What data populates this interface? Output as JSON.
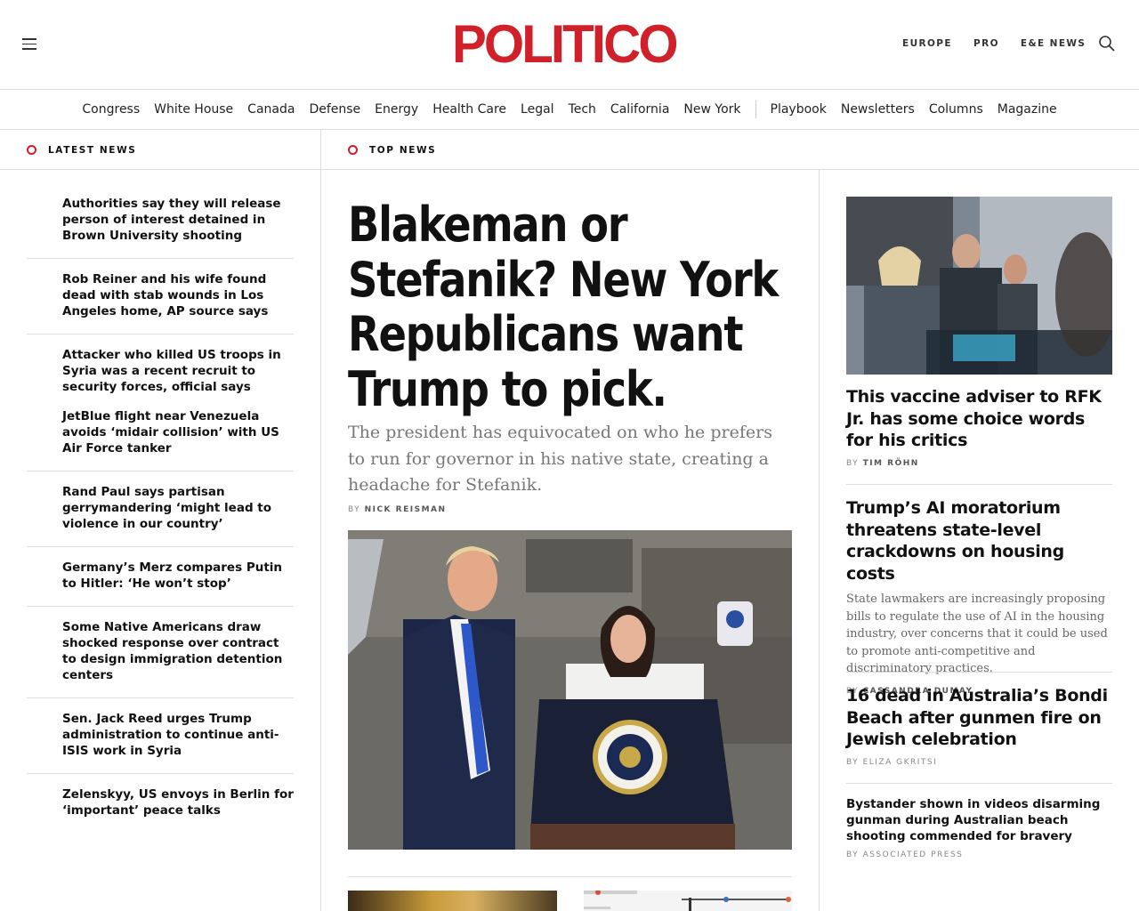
{
  "header": {
    "logo": "POLITICO",
    "links": [
      "EUROPE",
      "PRO",
      "E&E NEWS"
    ]
  },
  "nav": {
    "sections": [
      "Congress",
      "White House",
      "Canada",
      "Defense",
      "Energy",
      "Health Care",
      "Legal",
      "Tech",
      "California",
      "New York"
    ],
    "extras": [
      "Playbook",
      "Newsletters",
      "Columns",
      "Magazine"
    ]
  },
  "columns": {
    "latest_label": "LATEST NEWS",
    "top_label": "TOP NEWS"
  },
  "latest_news": [
    "Authorities say they will release person of interest detained in Brown University shooting",
    "Rob Reiner and his wife found dead with stab wounds in Los Angeles home, AP source says",
    "Attacker who killed US troops in Syria was a recent recruit to security forces, official says",
    "JetBlue flight near Venezuela avoids ‘midair collision’ with US Air Force tanker",
    "Rand Paul says partisan gerrymandering ‘might lead to violence in our country’",
    "Germany’s Merz compares Putin to Hitler: ‘He won’t stop’",
    "Some Native Americans draw shocked response over contract to design immigration detention centers",
    "Sen. Jack Reed urges Trump administration to continue anti-ISIS work in Syria",
    "Zelenskyy, US envoys in Berlin for ‘important’ peace talks"
  ],
  "lead": {
    "title": "Blakeman or Stefanik? New York Republicans want Trump to pick.",
    "dek": "The president has equivocated on who he prefers to run for governor in his native state, creating a headache for Stefanik.",
    "by": "BY",
    "author": "NICK REISMAN"
  },
  "right": [
    {
      "title": "This vaccine adviser to RFK Jr. has some choice words for his critics",
      "by": "BY",
      "author": "TIM RÖHN"
    },
    {
      "title": "Trump’s AI moratorium threatens state-level crackdowns on housing costs",
      "dek": "State lawmakers are increasingly proposing bills to regulate the use of AI in the housing industry, over concerns that it could be used to promote anti-competitive and discriminatory practices.",
      "by": "BY",
      "author": "CASSANDRA DUMAY"
    },
    {
      "title": "16 dead in Australia’s Bondi Beach after gunmen fire on Jewish celebration",
      "by": "BY",
      "author": "ELIZA GKRITSI"
    },
    {
      "title": "Bystander shown in videos disarming gunman during Australian beach shooting commended for bravery",
      "by": "BY",
      "author": "ASSOCIATED PRESS"
    }
  ],
  "seal_text": "SEAL OF THE PRESIDENT OF THE UNITED STATES",
  "colors": {
    "brand": "#d0202a"
  }
}
